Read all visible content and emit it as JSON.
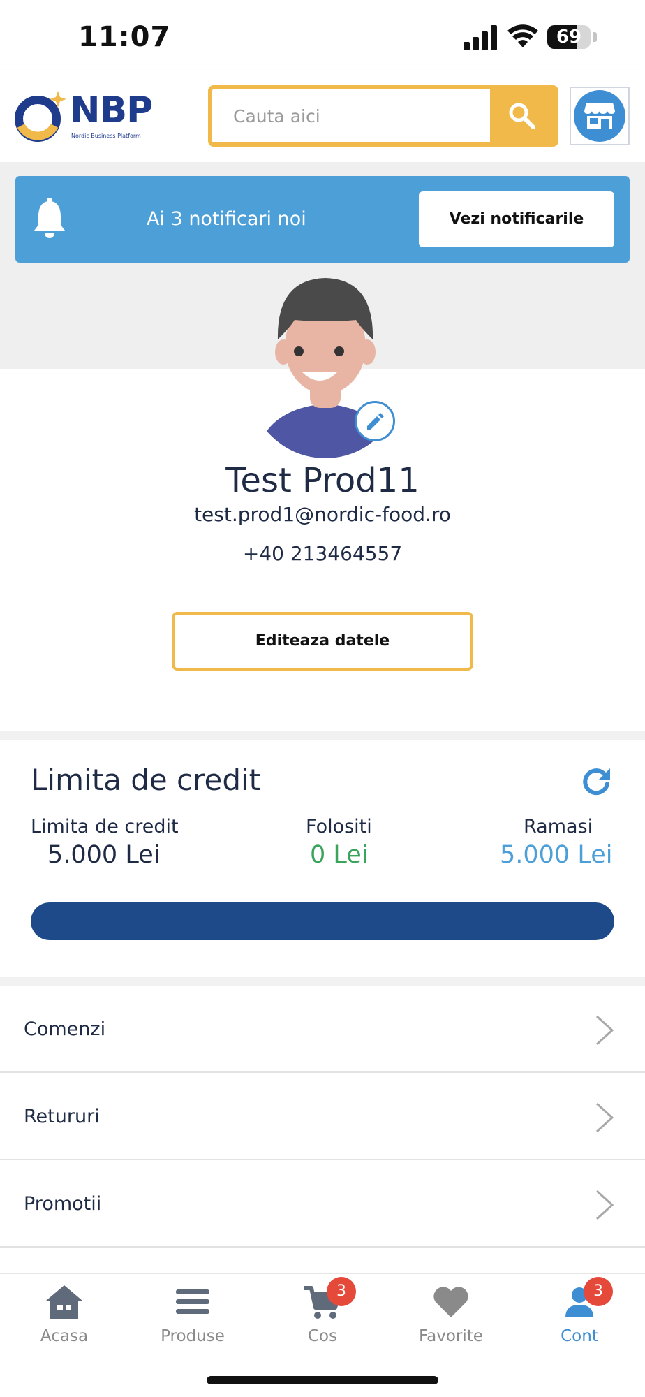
{
  "status_bar": {
    "time": "11:07",
    "battery": "69",
    "battery_level": 0.69
  },
  "header": {
    "logo_text": "NBP",
    "logo_subtitle": "Nordic Business Platform",
    "search": {
      "placeholder": "Cauta aici",
      "value": ""
    },
    "colors": {
      "accent": "#f0b94a",
      "brand": "#1f3b8c",
      "store_icon": "#3e8ed3"
    }
  },
  "notification": {
    "text": "Ai 3 notificari noi",
    "button_label": "Vezi notificarile",
    "icon": "bell-icon",
    "color": "#4d9fd8"
  },
  "profile": {
    "name": "Test Prod11",
    "email": "test.prod1@nordic-food.ro",
    "phone": "+40 213464557",
    "edit_button": "Editeaza datele"
  },
  "credit": {
    "title": "Limita de credit",
    "limit_label": "Limita de credit",
    "limit_value": "5.000 Lei",
    "used_label": "Folositi",
    "used_value": "0 Lei",
    "remaining_label": "Ramasi",
    "remaining_value": "5.000 Lei",
    "remaining_fraction": 1.0,
    "colors": {
      "used": "#3aa35c",
      "remaining": "#4d9fd8",
      "bar": "#1f4a8a"
    }
  },
  "menu": {
    "items": [
      {
        "label": "Comenzi"
      },
      {
        "label": "Retururi"
      },
      {
        "label": "Promotii"
      }
    ]
  },
  "bottom_nav": {
    "items": [
      {
        "label": "Acasa",
        "icon": "home-icon"
      },
      {
        "label": "Produse",
        "icon": "menu-icon"
      },
      {
        "label": "Cos",
        "icon": "cart-icon",
        "badge": "3"
      },
      {
        "label": "Favorite",
        "icon": "heart-icon"
      },
      {
        "label": "Cont",
        "icon": "account-icon",
        "badge": "3",
        "active": true
      }
    ]
  }
}
